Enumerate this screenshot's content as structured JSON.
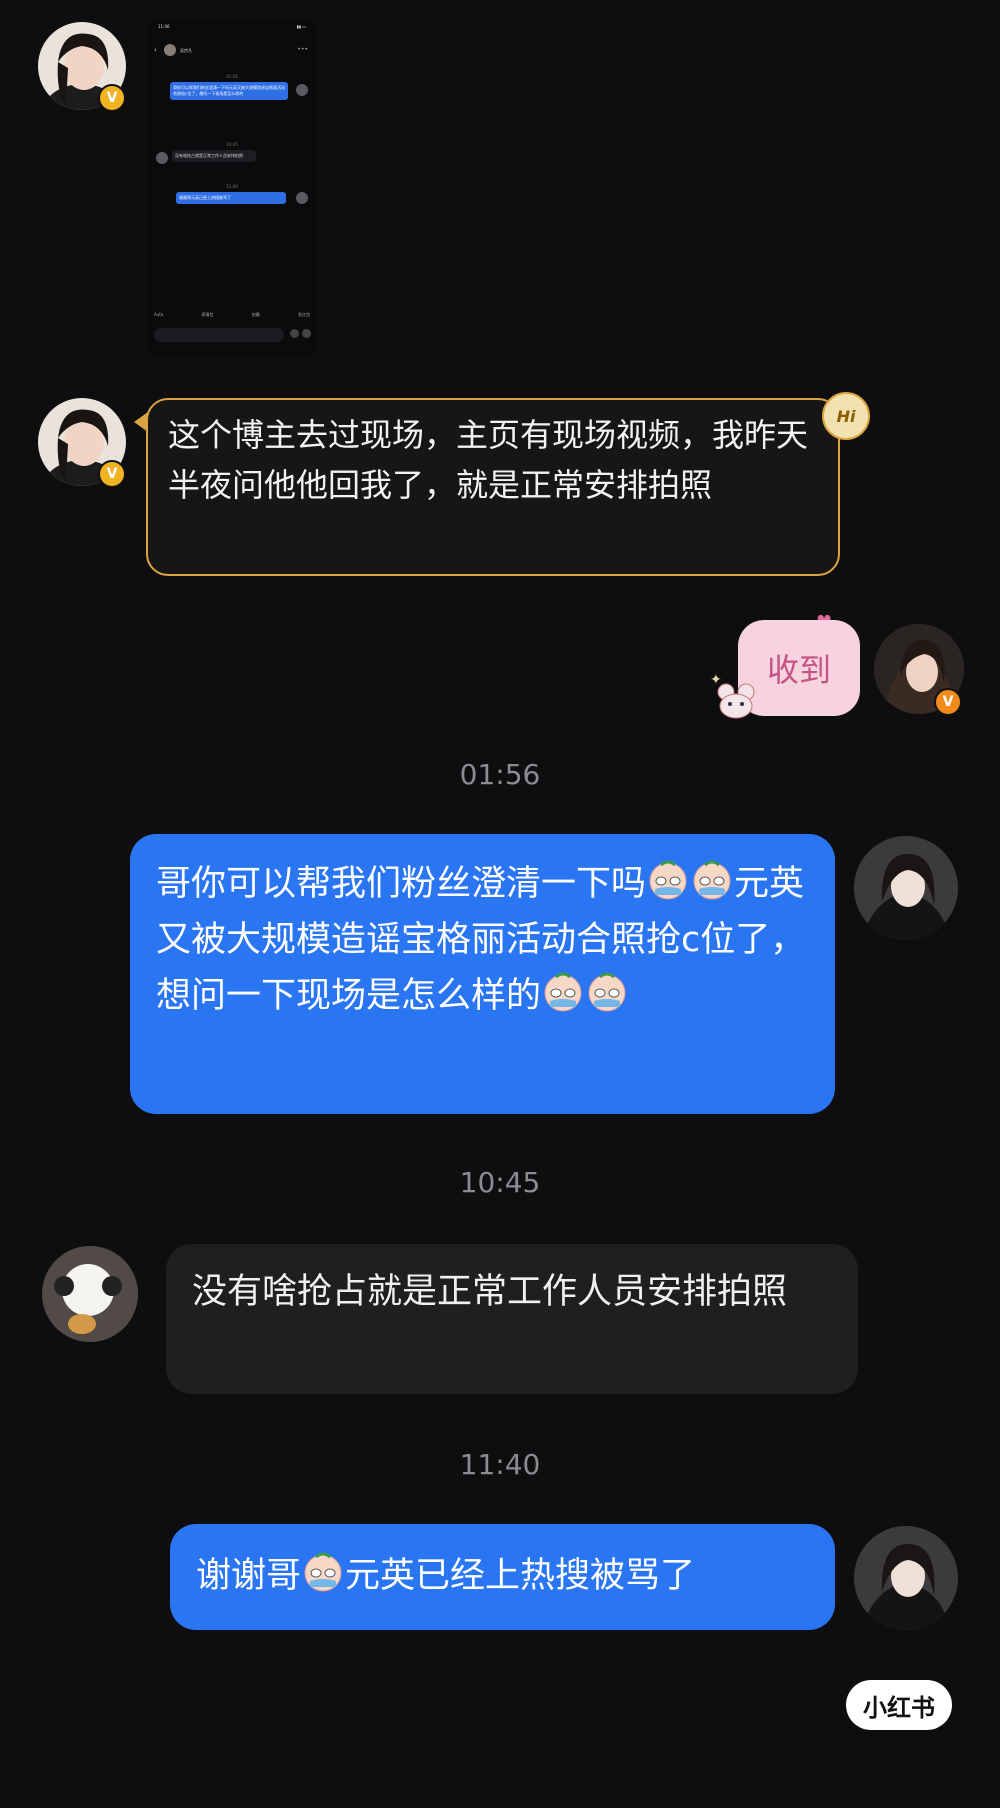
{
  "embedded_screenshot": {
    "status_time": "11:06",
    "contact_name": "吴宗凡",
    "ts1": "01:56",
    "msg1": "哥你可以帮我们粉丝澄清一下吗元英又被大规模造谣宝格丽活动合照抢c位了，想问一下现场是怎么样的",
    "ts2": "10:45",
    "msg2": "没有啥抢占就是正常工作人员安排拍照",
    "ts3": "11:40",
    "msg3": "谢谢哥元英已经上热搜被骂了",
    "toolbar_items": [
      "Auto",
      "表情包",
      "拍摄",
      "发红包"
    ]
  },
  "sticker_message": {
    "text": "这个博主去过现场，主页有现场视频，我昨天半夜问他他回我了，就是正常安排拍照",
    "tag": "Hi"
  },
  "reply_sticker": {
    "text": "收到"
  },
  "chat": {
    "ts1": "01:56",
    "msg1_parts": [
      "哥你可以帮我们粉丝澄清一下吗",
      "元英又被大规模造谣宝格丽活动合照抢c位了，想问一下现场是怎么样的"
    ],
    "ts2": "10:45",
    "msg2": "没有啥抢占就是正常工作人员安排拍照",
    "ts3": "11:40",
    "msg3_parts": [
      "谢谢哥",
      "元英已经上热搜被骂了"
    ]
  },
  "watermark": "小红书",
  "colors": {
    "background": "#0e0e10",
    "sent_bubble": "#2a75f2",
    "received_bubble": "#1f1f22",
    "verified_badge": "#f0b323",
    "sticker_border": "#d9a441"
  }
}
